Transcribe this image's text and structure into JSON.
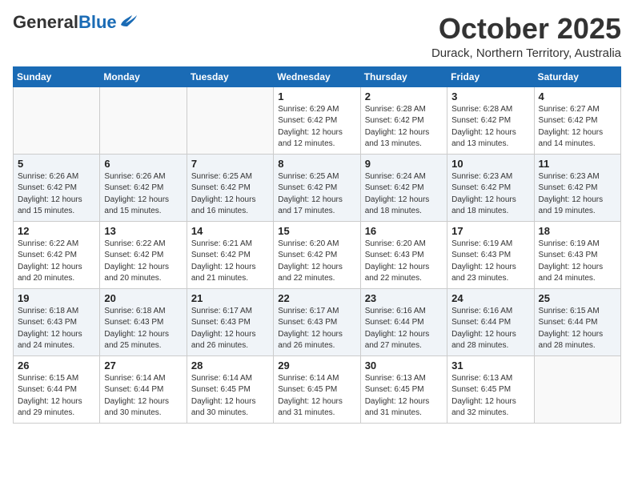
{
  "header": {
    "logo_general": "General",
    "logo_blue": "Blue",
    "month_title": "October 2025",
    "location": "Durack, Northern Territory, Australia"
  },
  "calendar": {
    "headers": [
      "Sunday",
      "Monday",
      "Tuesday",
      "Wednesday",
      "Thursday",
      "Friday",
      "Saturday"
    ],
    "rows": [
      [
        {
          "day": "",
          "info": ""
        },
        {
          "day": "",
          "info": ""
        },
        {
          "day": "",
          "info": ""
        },
        {
          "day": "1",
          "info": "Sunrise: 6:29 AM\nSunset: 6:42 PM\nDaylight: 12 hours\nand 12 minutes."
        },
        {
          "day": "2",
          "info": "Sunrise: 6:28 AM\nSunset: 6:42 PM\nDaylight: 12 hours\nand 13 minutes."
        },
        {
          "day": "3",
          "info": "Sunrise: 6:28 AM\nSunset: 6:42 PM\nDaylight: 12 hours\nand 13 minutes."
        },
        {
          "day": "4",
          "info": "Sunrise: 6:27 AM\nSunset: 6:42 PM\nDaylight: 12 hours\nand 14 minutes."
        }
      ],
      [
        {
          "day": "5",
          "info": "Sunrise: 6:26 AM\nSunset: 6:42 PM\nDaylight: 12 hours\nand 15 minutes."
        },
        {
          "day": "6",
          "info": "Sunrise: 6:26 AM\nSunset: 6:42 PM\nDaylight: 12 hours\nand 15 minutes."
        },
        {
          "day": "7",
          "info": "Sunrise: 6:25 AM\nSunset: 6:42 PM\nDaylight: 12 hours\nand 16 minutes."
        },
        {
          "day": "8",
          "info": "Sunrise: 6:25 AM\nSunset: 6:42 PM\nDaylight: 12 hours\nand 17 minutes."
        },
        {
          "day": "9",
          "info": "Sunrise: 6:24 AM\nSunset: 6:42 PM\nDaylight: 12 hours\nand 18 minutes."
        },
        {
          "day": "10",
          "info": "Sunrise: 6:23 AM\nSunset: 6:42 PM\nDaylight: 12 hours\nand 18 minutes."
        },
        {
          "day": "11",
          "info": "Sunrise: 6:23 AM\nSunset: 6:42 PM\nDaylight: 12 hours\nand 19 minutes."
        }
      ],
      [
        {
          "day": "12",
          "info": "Sunrise: 6:22 AM\nSunset: 6:42 PM\nDaylight: 12 hours\nand 20 minutes."
        },
        {
          "day": "13",
          "info": "Sunrise: 6:22 AM\nSunset: 6:42 PM\nDaylight: 12 hours\nand 20 minutes."
        },
        {
          "day": "14",
          "info": "Sunrise: 6:21 AM\nSunset: 6:42 PM\nDaylight: 12 hours\nand 21 minutes."
        },
        {
          "day": "15",
          "info": "Sunrise: 6:20 AM\nSunset: 6:42 PM\nDaylight: 12 hours\nand 22 minutes."
        },
        {
          "day": "16",
          "info": "Sunrise: 6:20 AM\nSunset: 6:43 PM\nDaylight: 12 hours\nand 22 minutes."
        },
        {
          "day": "17",
          "info": "Sunrise: 6:19 AM\nSunset: 6:43 PM\nDaylight: 12 hours\nand 23 minutes."
        },
        {
          "day": "18",
          "info": "Sunrise: 6:19 AM\nSunset: 6:43 PM\nDaylight: 12 hours\nand 24 minutes."
        }
      ],
      [
        {
          "day": "19",
          "info": "Sunrise: 6:18 AM\nSunset: 6:43 PM\nDaylight: 12 hours\nand 24 minutes."
        },
        {
          "day": "20",
          "info": "Sunrise: 6:18 AM\nSunset: 6:43 PM\nDaylight: 12 hours\nand 25 minutes."
        },
        {
          "day": "21",
          "info": "Sunrise: 6:17 AM\nSunset: 6:43 PM\nDaylight: 12 hours\nand 26 minutes."
        },
        {
          "day": "22",
          "info": "Sunrise: 6:17 AM\nSunset: 6:43 PM\nDaylight: 12 hours\nand 26 minutes."
        },
        {
          "day": "23",
          "info": "Sunrise: 6:16 AM\nSunset: 6:44 PM\nDaylight: 12 hours\nand 27 minutes."
        },
        {
          "day": "24",
          "info": "Sunrise: 6:16 AM\nSunset: 6:44 PM\nDaylight: 12 hours\nand 28 minutes."
        },
        {
          "day": "25",
          "info": "Sunrise: 6:15 AM\nSunset: 6:44 PM\nDaylight: 12 hours\nand 28 minutes."
        }
      ],
      [
        {
          "day": "26",
          "info": "Sunrise: 6:15 AM\nSunset: 6:44 PM\nDaylight: 12 hours\nand 29 minutes."
        },
        {
          "day": "27",
          "info": "Sunrise: 6:14 AM\nSunset: 6:44 PM\nDaylight: 12 hours\nand 30 minutes."
        },
        {
          "day": "28",
          "info": "Sunrise: 6:14 AM\nSunset: 6:45 PM\nDaylight: 12 hours\nand 30 minutes."
        },
        {
          "day": "29",
          "info": "Sunrise: 6:14 AM\nSunset: 6:45 PM\nDaylight: 12 hours\nand 31 minutes."
        },
        {
          "day": "30",
          "info": "Sunrise: 6:13 AM\nSunset: 6:45 PM\nDaylight: 12 hours\nand 31 minutes."
        },
        {
          "day": "31",
          "info": "Sunrise: 6:13 AM\nSunset: 6:45 PM\nDaylight: 12 hours\nand 32 minutes."
        },
        {
          "day": "",
          "info": ""
        }
      ]
    ]
  }
}
